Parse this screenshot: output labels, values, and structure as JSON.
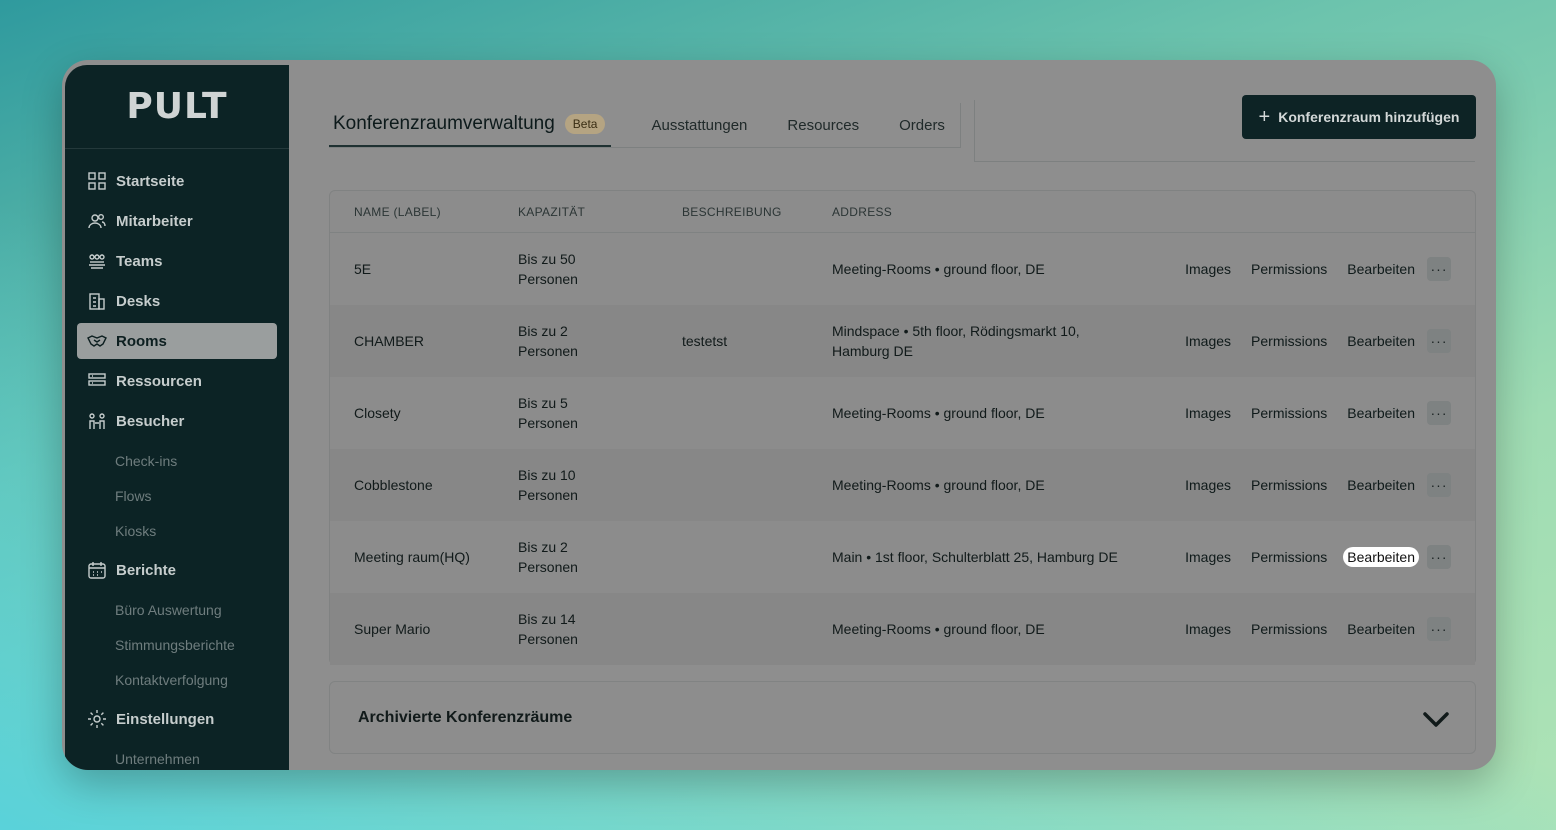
{
  "app": {
    "logo": "PULT"
  },
  "sidebar": {
    "items": [
      {
        "label": "Startseite",
        "icon": "grid-icon"
      },
      {
        "label": "Mitarbeiter",
        "icon": "users-icon"
      },
      {
        "label": "Teams",
        "icon": "team-icon"
      },
      {
        "label": "Desks",
        "icon": "building-icon"
      },
      {
        "label": "Rooms",
        "icon": "handshake-icon",
        "active": true
      },
      {
        "label": "Ressourcen",
        "icon": "resources-icon"
      },
      {
        "label": "Besucher",
        "icon": "visitors-icon"
      }
    ],
    "besucher_sub": [
      "Check-ins",
      "Flows",
      "Kiosks"
    ],
    "berichte": {
      "label": "Berichte",
      "icon": "calendar-icon"
    },
    "berichte_sub": [
      "Büro Auswertung",
      "Stimmungsberichte",
      "Kontaktverfolgung"
    ],
    "einstellungen": {
      "label": "Einstellungen",
      "icon": "gear-icon"
    },
    "einstellungen_sub": [
      "Unternehmen"
    ]
  },
  "tabs": {
    "active": "Konferenzraumverwaltung",
    "badge": "Beta",
    "others": [
      "Ausstattungen",
      "Resources",
      "Orders"
    ]
  },
  "add_button": {
    "label": "Konferenzraum hinzufügen"
  },
  "table": {
    "headers": [
      "NAME (LABEL)",
      "KAPAZITÄT",
      "BESCHREIBUNG",
      "ADDRESS"
    ],
    "action_labels": {
      "images": "Images",
      "permissions": "Permissions",
      "edit": "Bearbeiten",
      "more": "···"
    },
    "rows": [
      {
        "name": "5E",
        "capacity_line1": "Bis zu 50",
        "capacity_line2": "Personen",
        "description": "",
        "address": "Meeting-Rooms • ground floor, DE"
      },
      {
        "name": "CHAMBER",
        "capacity_line1": "Bis zu 2",
        "capacity_line2": "Personen",
        "description": "testetst",
        "address": "Mindspace • 5th floor, Rödingsmarkt 10, Hamburg DE"
      },
      {
        "name": "Closety",
        "capacity_line1": "Bis zu 5",
        "capacity_line2": "Personen",
        "description": "",
        "address": "Meeting-Rooms • ground floor, DE"
      },
      {
        "name": "Cobblestone",
        "capacity_line1": "Bis zu 10",
        "capacity_line2": "Personen",
        "description": "",
        "address": "Meeting-Rooms • ground floor, DE"
      },
      {
        "name": "Meeting raum(HQ)",
        "capacity_line1": "Bis zu 2",
        "capacity_line2": "Personen",
        "description": "",
        "address": "Main • 1st floor, Schulterblatt 25, Hamburg DE",
        "edit_highlighted": true
      },
      {
        "name": "Super Mario",
        "capacity_line1": "Bis zu 14",
        "capacity_line2": "Personen",
        "description": "",
        "address": "Meeting-Rooms • ground floor, DE"
      }
    ]
  },
  "archive": {
    "label": "Archivierte Konferenzräume"
  }
}
